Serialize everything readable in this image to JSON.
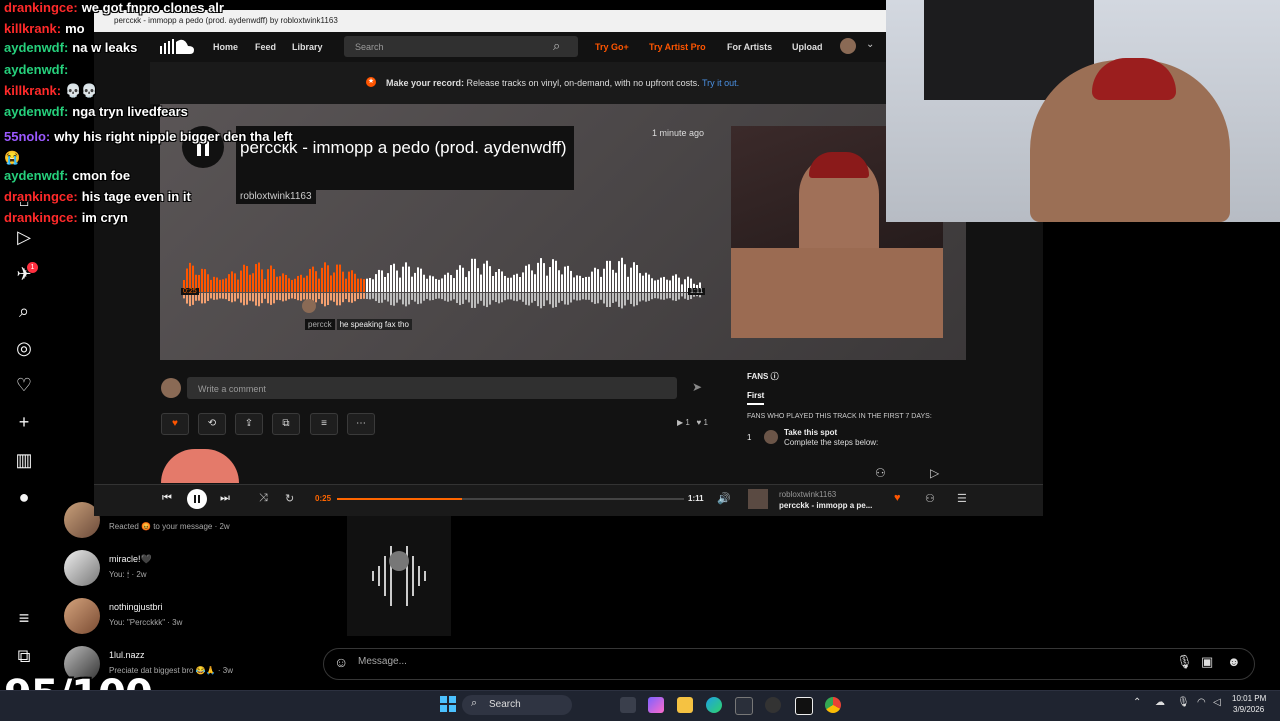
{
  "instagram": {
    "conversations": [
      {
        "name": "",
        "preview": "Reacted 😡 to your message · 2w"
      },
      {
        "name": "miracle!🖤",
        "preview": "You: 🕯 · 2w"
      },
      {
        "name": "nothingjustbri",
        "preview": "You: \"Percckkk\" · 3w"
      },
      {
        "name": "1lul.nazz",
        "preview": "Preciate dat biggest bro 😂🙏 · 3w"
      }
    ],
    "message_placeholder": "Message...",
    "notification_badge": "1"
  },
  "soundcloud": {
    "tab_title": "perccкk - immopp a pedo (prod. aydenwdff) by robloxtwink1163",
    "nav": {
      "home": "Home",
      "feed": "Feed",
      "library": "Library",
      "search_placeholder": "Search",
      "try_go": "Try Go+",
      "try_artist": "Try Artist Pro",
      "for_artists": "For Artists",
      "upload": "Upload"
    },
    "banner": {
      "bold": "Make your record:",
      "text": " Release tracks on vinyl, on-demand, with no upfront costs.",
      "link": " Try it out."
    },
    "track": {
      "title": "perccкk - immopp a pedo (prod. aydenwdff)",
      "artist": "robloxtwink1163",
      "posted": "1 minute ago",
      "current_time": "0:25",
      "total_time": "1:11",
      "progress": 0.35,
      "wave_comment_user": "percck",
      "wave_comment_text": "he speaking fax tho"
    },
    "comment_placeholder": "Write a comment",
    "plays": "1",
    "likes": "1",
    "fans": {
      "title": "FANS",
      "tab": "First",
      "subtitle": "FANS WHO PLAYED THIS TRACK IN THE FIRST 7 DAYS:",
      "rank": "1",
      "name": "Take this spot",
      "desc": "Complete the steps below:"
    },
    "player": {
      "current": "0:25",
      "total": "1:11",
      "artist": "robloxtwink1163",
      "title": "percckk - immopp a pe..."
    },
    "accent": "#ff5500"
  },
  "chat": [
    {
      "user": "drankingce:",
      "msg": "we got fnpro clones alr",
      "color": "#ff2a2a"
    },
    {
      "user": "killkrank:",
      "msg": "mo",
      "color": "#ff2a2a"
    },
    {
      "user": "aydenwdf:",
      "msg": "na w leaks",
      "color": "#26d07c"
    },
    {
      "user": "aydenwdf:",
      "msg": "",
      "color": "#26d07c"
    },
    {
      "user": "killkrank:",
      "msg": "💀💀",
      "color": "#ff2a2a"
    },
    {
      "user": "aydenwdf:",
      "msg": "nga tryn livedfears",
      "color": "#26d07c"
    },
    {
      "user": "55nolo:",
      "msg": "why his right nipple bigger den tha left😭",
      "color": "#9b59ff"
    },
    {
      "user": "aydenwdf:",
      "msg": "cmon foe",
      "color": "#26d07c"
    },
    {
      "user": "drankingce:",
      "msg": "his tage even in it",
      "color": "#ff2a2a"
    },
    {
      "user": "drankingce:",
      "msg": "im cryn",
      "color": "#ff2a2a"
    }
  ],
  "score": "95/100",
  "taskbar": {
    "search": "Search",
    "time": "10:01 PM",
    "date": "3/9/2026"
  }
}
